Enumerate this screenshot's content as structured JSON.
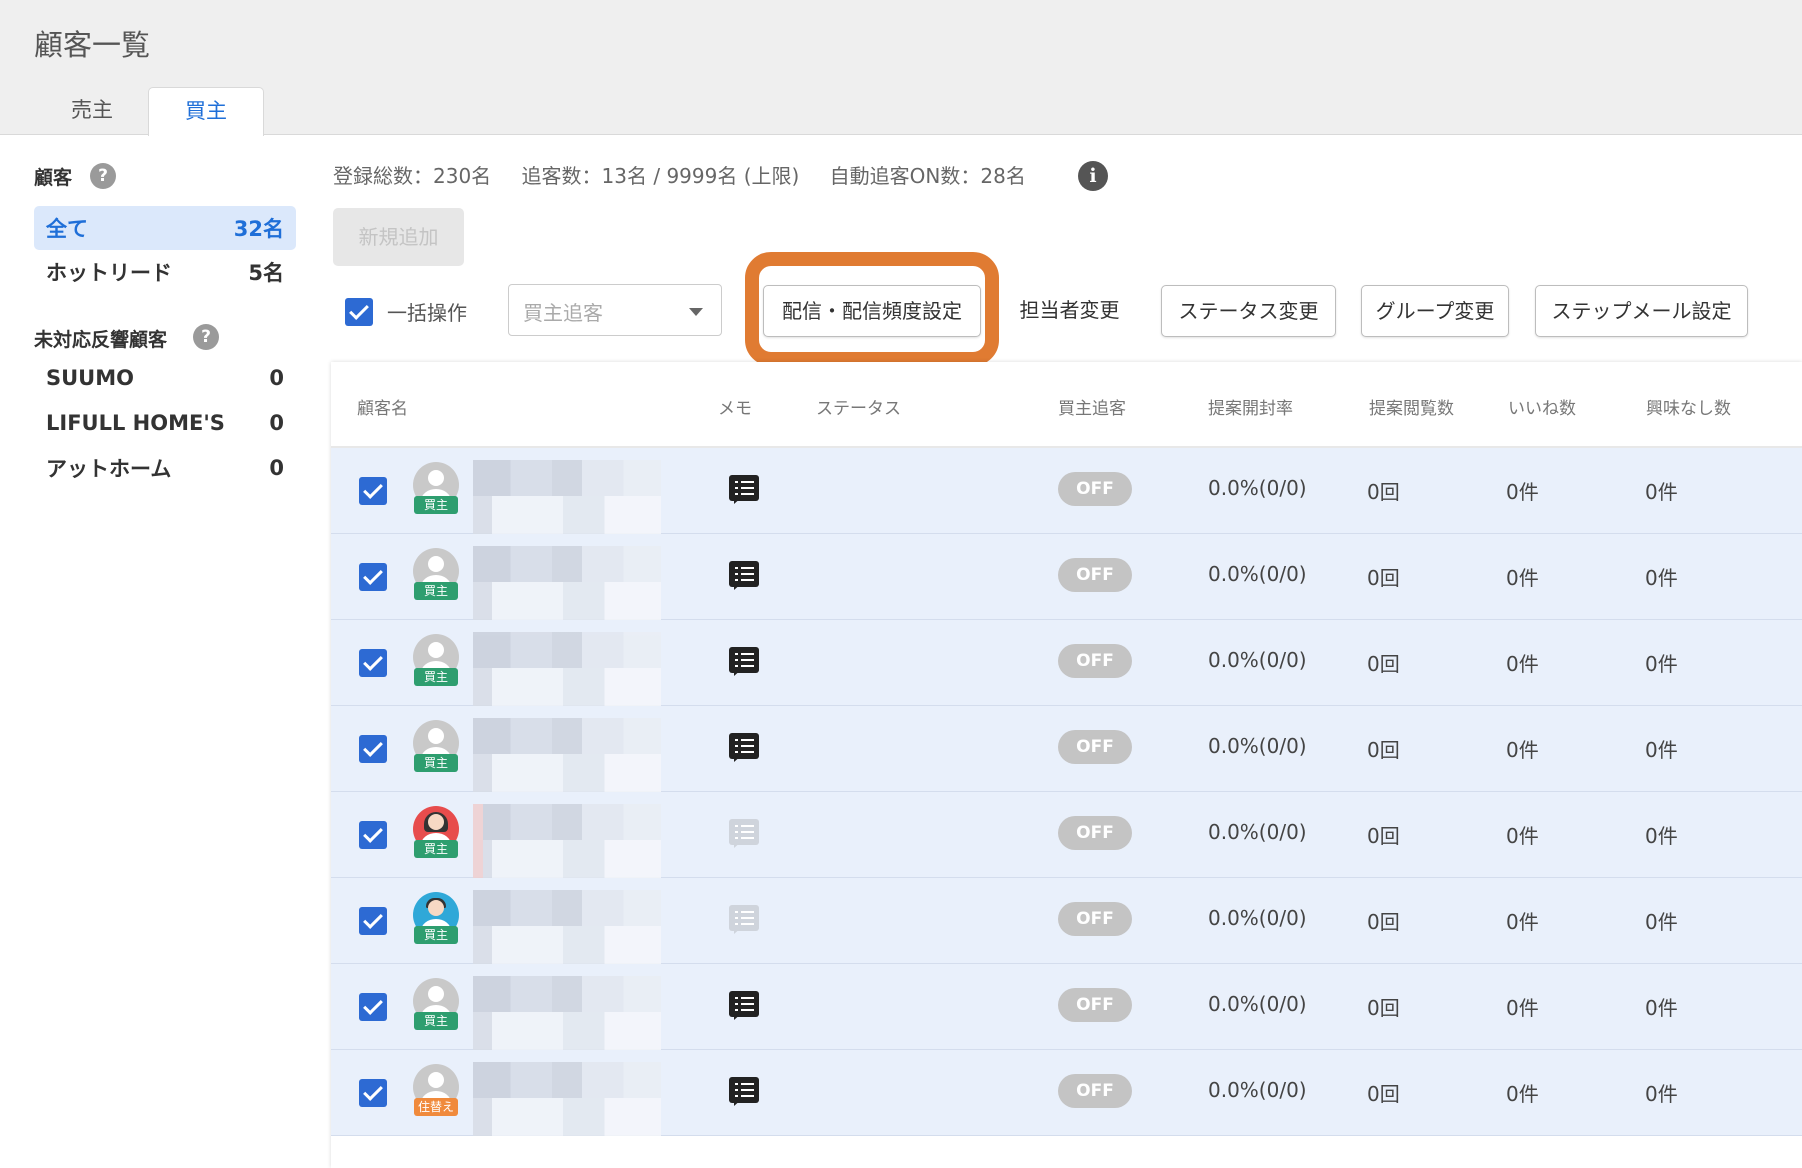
{
  "header": {
    "title": "顧客一覧",
    "tabs": [
      "売主",
      "買主"
    ]
  },
  "sidebar": {
    "customers_title": "顧客",
    "items": [
      {
        "label": "全て",
        "count": "32名"
      },
      {
        "label": "ホットリード",
        "count": "5名"
      }
    ],
    "unhandled_title": "未対応反響顧客",
    "portals": [
      {
        "label": "SUUMO",
        "count": "0"
      },
      {
        "label": "LIFULL HOME'S",
        "count": "0"
      },
      {
        "label": "アットホーム",
        "count": "0"
      }
    ],
    "help_glyph": "?"
  },
  "stats": {
    "total": "登録総数：230名",
    "tracking": "追客数：13名 / 9999名 (上限)",
    "auto": "自動追客ON数：28名",
    "info_glyph": "i"
  },
  "toolbar": {
    "new_label": "新規追加",
    "bulk_label": "一括操作",
    "select_placeholder": "買主追客",
    "buttons": [
      "配信・配信頻度設定",
      "担当者変更",
      "ステータス変更",
      "グループ変更",
      "ステップメール設定"
    ]
  },
  "table": {
    "headers": [
      "顧客名",
      "メモ",
      "ステータス",
      "買主追客",
      "提案開封率",
      "提案閲覧数",
      "いいね数",
      "興味なし数"
    ],
    "rows": [
      {
        "avatar": "default",
        "tag": "買主",
        "memo": "dark",
        "toggle": "OFF",
        "open_rate": "0.0%(0/0)",
        "views": "0回",
        "likes": "0件",
        "dislikes": "0件"
      },
      {
        "avatar": "default",
        "tag": "買主",
        "memo": "dark",
        "toggle": "OFF",
        "open_rate": "0.0%(0/0)",
        "views": "0回",
        "likes": "0件",
        "dislikes": "0件"
      },
      {
        "avatar": "default",
        "tag": "買主",
        "memo": "dark",
        "toggle": "OFF",
        "open_rate": "0.0%(0/0)",
        "views": "0回",
        "likes": "0件",
        "dislikes": "0件"
      },
      {
        "avatar": "default",
        "tag": "買主",
        "memo": "dark",
        "toggle": "OFF",
        "open_rate": "0.0%(0/0)",
        "views": "0回",
        "likes": "0件",
        "dislikes": "0件"
      },
      {
        "avatar": "female",
        "tag": "買主",
        "memo": "light",
        "toggle": "OFF",
        "open_rate": "0.0%(0/0)",
        "views": "0回",
        "likes": "0件",
        "dislikes": "0件"
      },
      {
        "avatar": "male",
        "tag": "買主",
        "memo": "light",
        "toggle": "OFF",
        "open_rate": "0.0%(0/0)",
        "views": "0回",
        "likes": "0件",
        "dislikes": "0件"
      },
      {
        "avatar": "default",
        "tag": "買主",
        "memo": "dark",
        "toggle": "OFF",
        "open_rate": "0.0%(0/0)",
        "views": "0回",
        "likes": "0件",
        "dislikes": "0件"
      },
      {
        "avatar": "default",
        "tag": "住替え",
        "memo": "dark",
        "toggle": "OFF",
        "open_rate": "0.0%(0/0)",
        "views": "0回",
        "likes": "0件",
        "dislikes": "0件"
      }
    ]
  },
  "colors": {
    "accent": "#1f6fd8",
    "highlight": "#e07b32",
    "row_bg": "#e9f0fb"
  }
}
